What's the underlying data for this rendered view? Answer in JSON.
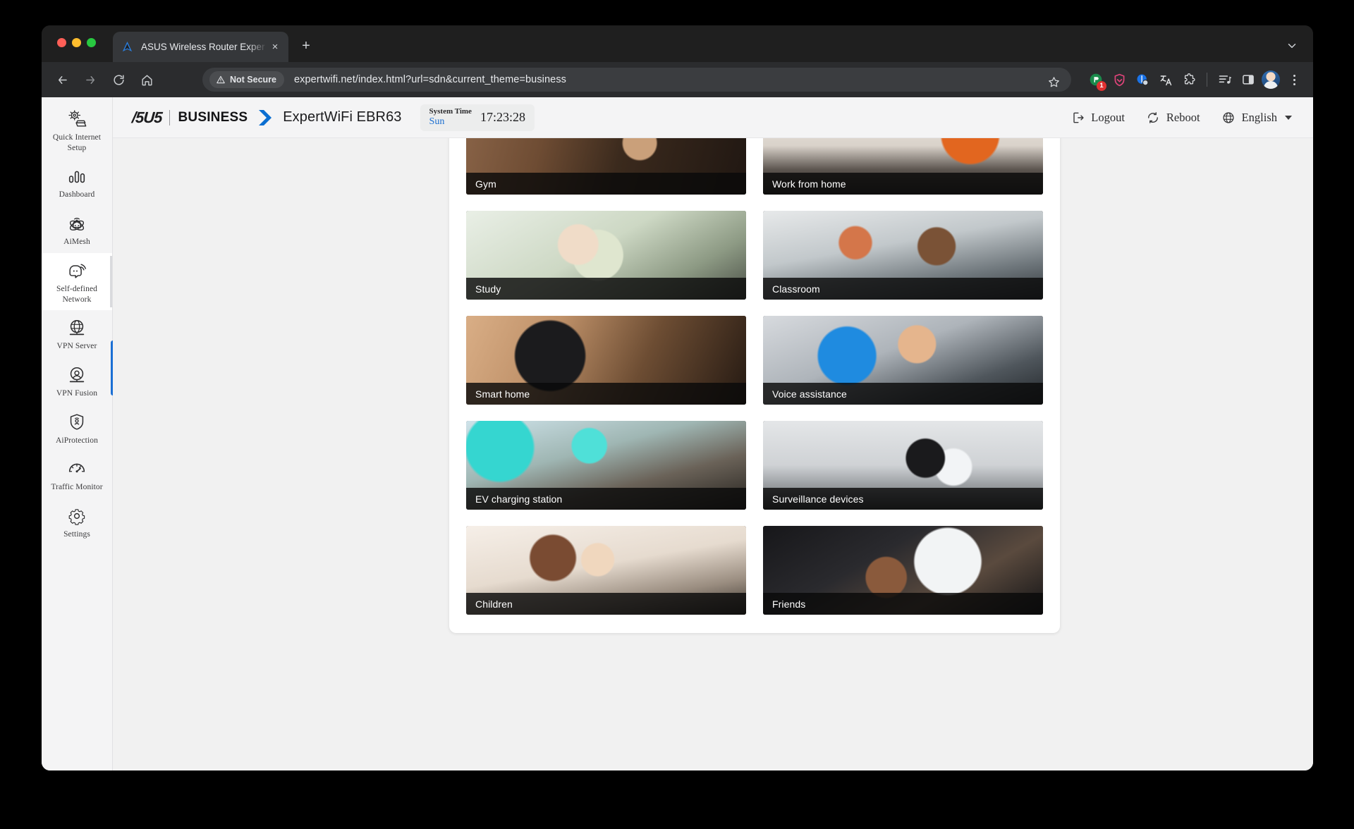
{
  "browser": {
    "tab": {
      "title": "ASUS Wireless Router Exper",
      "favicon_name": "asus-favicon",
      "close_label": "×"
    },
    "new_tab_label": "+",
    "omnibox": {
      "security_chip": "Not Secure",
      "url": "expertwifi.net/index.html?url=sdn&current_theme=business"
    },
    "extensions": [
      {
        "name": "extension-green-icon",
        "badge": "1"
      },
      {
        "name": "shield-extension-icon",
        "badge": ""
      },
      {
        "name": "privacy-extension-icon",
        "badge": ""
      },
      {
        "name": "translate-extension-icon",
        "badge": ""
      },
      {
        "name": "puzzle-extensions-icon",
        "badge": ""
      },
      {
        "name": "reading-list-icon",
        "badge": ""
      },
      {
        "name": "side-panel-icon",
        "badge": ""
      }
    ]
  },
  "sidebar": {
    "items": [
      {
        "label": "Quick Internet Setup",
        "icon": "quick-setup-icon",
        "active": false
      },
      {
        "label": "Dashboard",
        "icon": "dashboard-icon",
        "active": false
      },
      {
        "label": "AiMesh",
        "icon": "aimesh-icon",
        "active": false
      },
      {
        "label": "Self-defined Network",
        "icon": "self-defined-network-icon",
        "active": true
      },
      {
        "label": "VPN Server",
        "icon": "vpn-server-icon",
        "active": false
      },
      {
        "label": "VPN Fusion",
        "icon": "vpn-fusion-icon",
        "active": false
      },
      {
        "label": "AiProtection",
        "icon": "aiprotection-icon",
        "active": false
      },
      {
        "label": "Traffic Monitor",
        "icon": "traffic-monitor-icon",
        "active": false
      },
      {
        "label": "Settings",
        "icon": "settings-gear-icon",
        "active": false
      }
    ]
  },
  "header": {
    "brand": "/5U5",
    "brand_suffix": "BUSINESS",
    "model": "ExpertWiFi EBR63",
    "system_time": {
      "label": "System Time",
      "day": "Sun",
      "clock": "17:23:28"
    },
    "actions": {
      "logout": "Logout",
      "reboot": "Reboot",
      "language": "English"
    }
  },
  "main": {
    "cards": [
      {
        "label": "Gym",
        "art": "art-gym"
      },
      {
        "label": "Work from home",
        "art": "art-wfh"
      },
      {
        "label": "Study",
        "art": "art-study"
      },
      {
        "label": "Classroom",
        "art": "art-classroom"
      },
      {
        "label": "Smart home",
        "art": "art-smarthome"
      },
      {
        "label": "Voice assistance",
        "art": "art-voice"
      },
      {
        "label": "EV charging station",
        "art": "art-ev"
      },
      {
        "label": "Surveillance devices",
        "art": "art-surveil"
      },
      {
        "label": "Children",
        "art": "art-children"
      },
      {
        "label": "Friends",
        "art": "art-friends"
      }
    ]
  },
  "colors": {
    "accent_blue": "#0a6ed1",
    "scroll_thumb": "#1b6fd4",
    "panel_bg": "#ffffff",
    "page_bg": "#f1f1f1"
  }
}
